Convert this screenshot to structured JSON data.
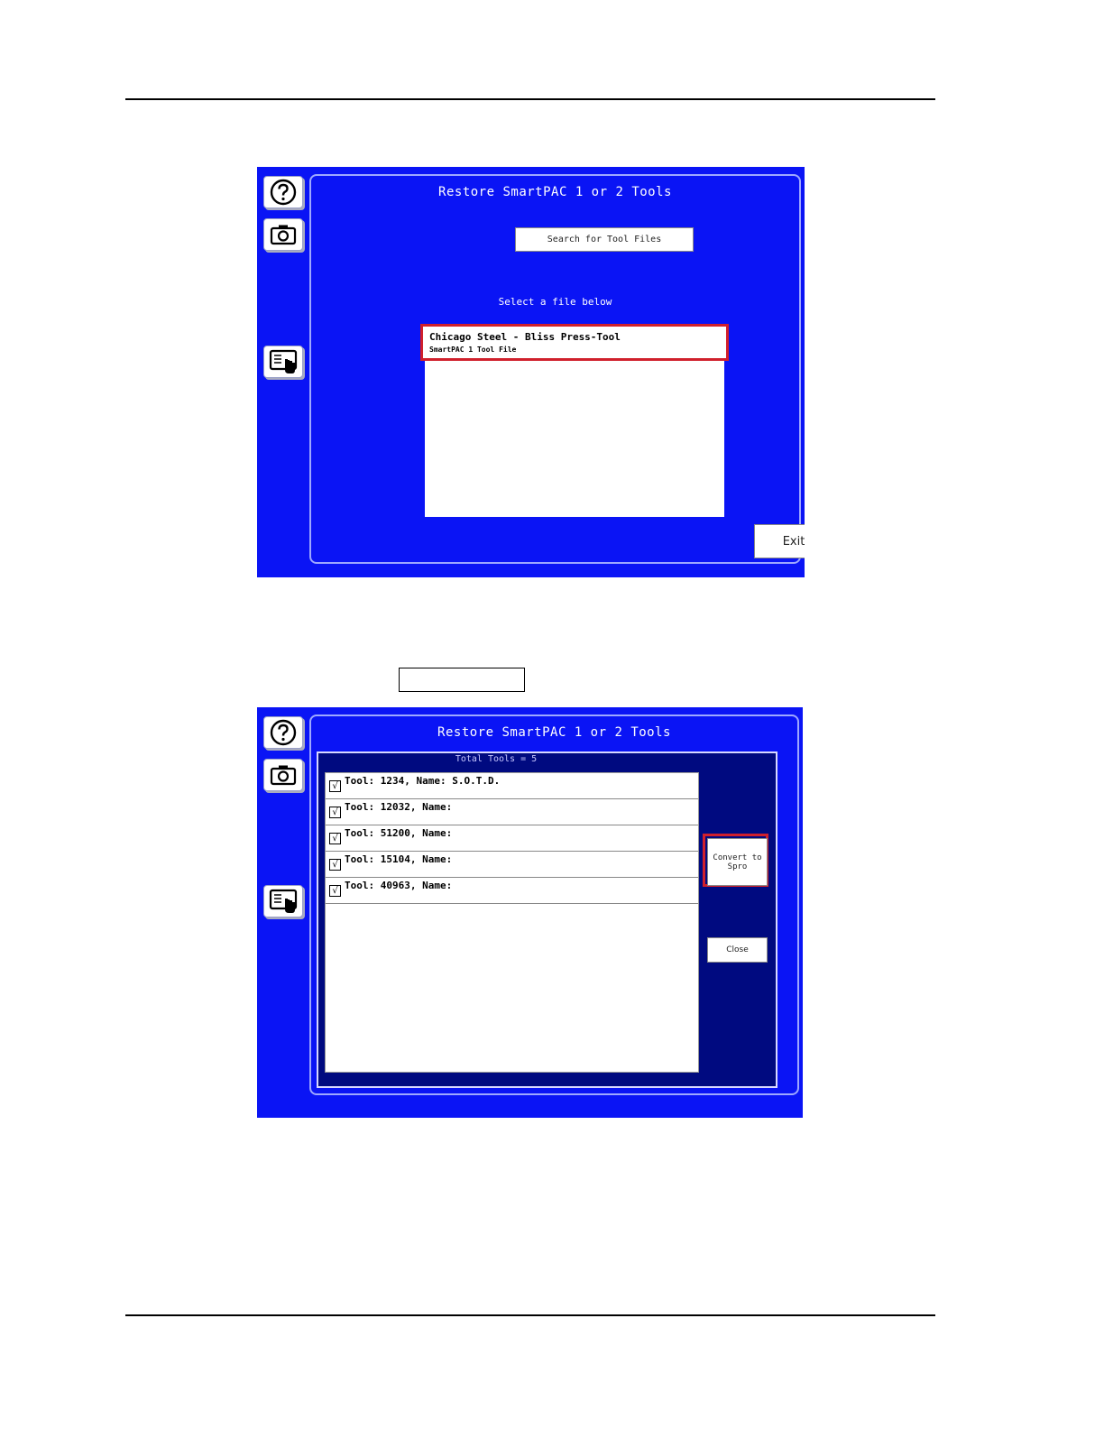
{
  "screen1": {
    "title": "Restore SmartPAC 1 or 2 Tools",
    "search_button": "Search for Tool Files",
    "select_label": "Select a file below",
    "file_item": {
      "name": "Chicago Steel - Bliss Press-Tool",
      "subtitle": "SmartPAC 1 Tool File"
    },
    "exit_button": "Exit"
  },
  "screen2": {
    "title": "Restore SmartPAC 1 or 2 Tools",
    "total_tools": "Total Tools = 5",
    "tools": [
      {
        "label": "Tool: 1234, Name: S.O.T.D.",
        "checked": "√"
      },
      {
        "label": "Tool: 12032, Name:",
        "checked": "√"
      },
      {
        "label": "Tool: 51200, Name:",
        "checked": "√"
      },
      {
        "label": "Tool: 15104, Name:",
        "checked": "√"
      },
      {
        "label": "Tool: 40963, Name:",
        "checked": "√"
      }
    ],
    "convert_button": "Convert to Spro",
    "close_button": "Close"
  },
  "icons": [
    "help-icon",
    "camera-icon",
    "touchscreen-icon"
  ],
  "colors": {
    "screen_bg": "#0a14f5",
    "highlight": "#d0202c",
    "frame_bg": "#000a80"
  }
}
